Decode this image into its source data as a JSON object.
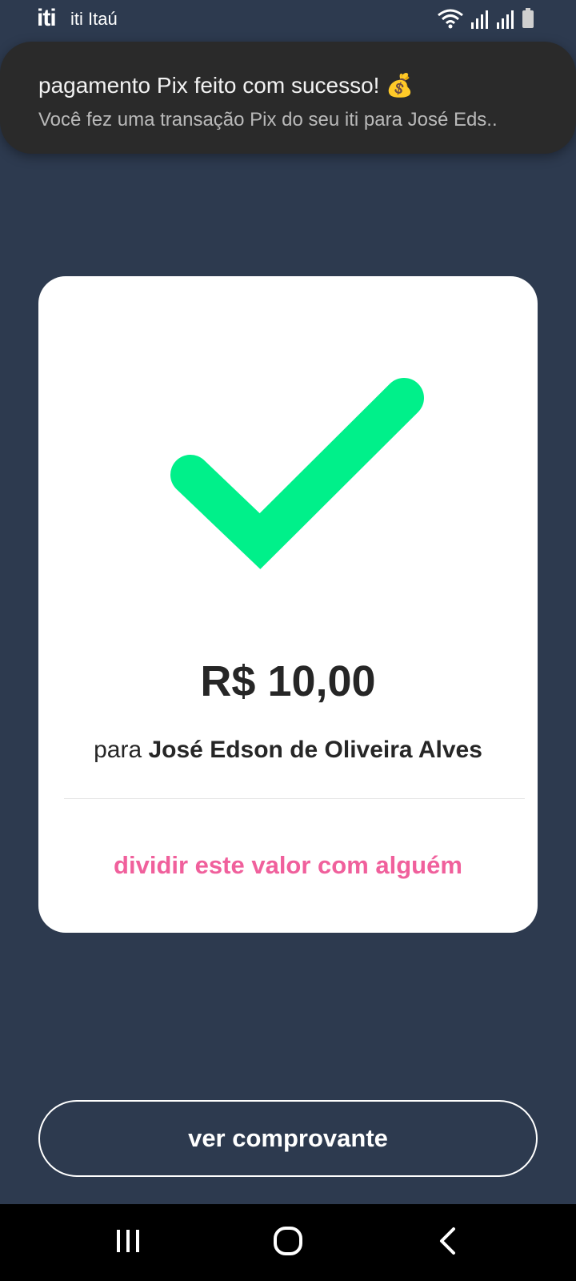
{
  "status_bar": {
    "logo_text": "iti",
    "app_name": "iti Itaú",
    "icons": [
      "wifi-icon",
      "signal-icon",
      "signal-icon",
      "battery-icon"
    ]
  },
  "notification": {
    "title": "pagamento Pix feito com sucesso! 💰",
    "body": "Você fez uma transação Pix do seu iti para José Eds.."
  },
  "card": {
    "status_icon": "checkmark-icon",
    "amount": "R$ 10,00",
    "recipient_prefix": "para ",
    "recipient_name": "José Edson de Oliveira Alves",
    "split_link": "dividir este valor com alguém"
  },
  "actions": {
    "receipt_button": "ver comprovante"
  },
  "nav_bar": {
    "icons": [
      "recent-apps-icon",
      "home-icon",
      "back-icon"
    ]
  },
  "colors": {
    "background": "#2d3a4f",
    "check": "#00f08a",
    "link": "#f0609c",
    "card": "#ffffff"
  }
}
